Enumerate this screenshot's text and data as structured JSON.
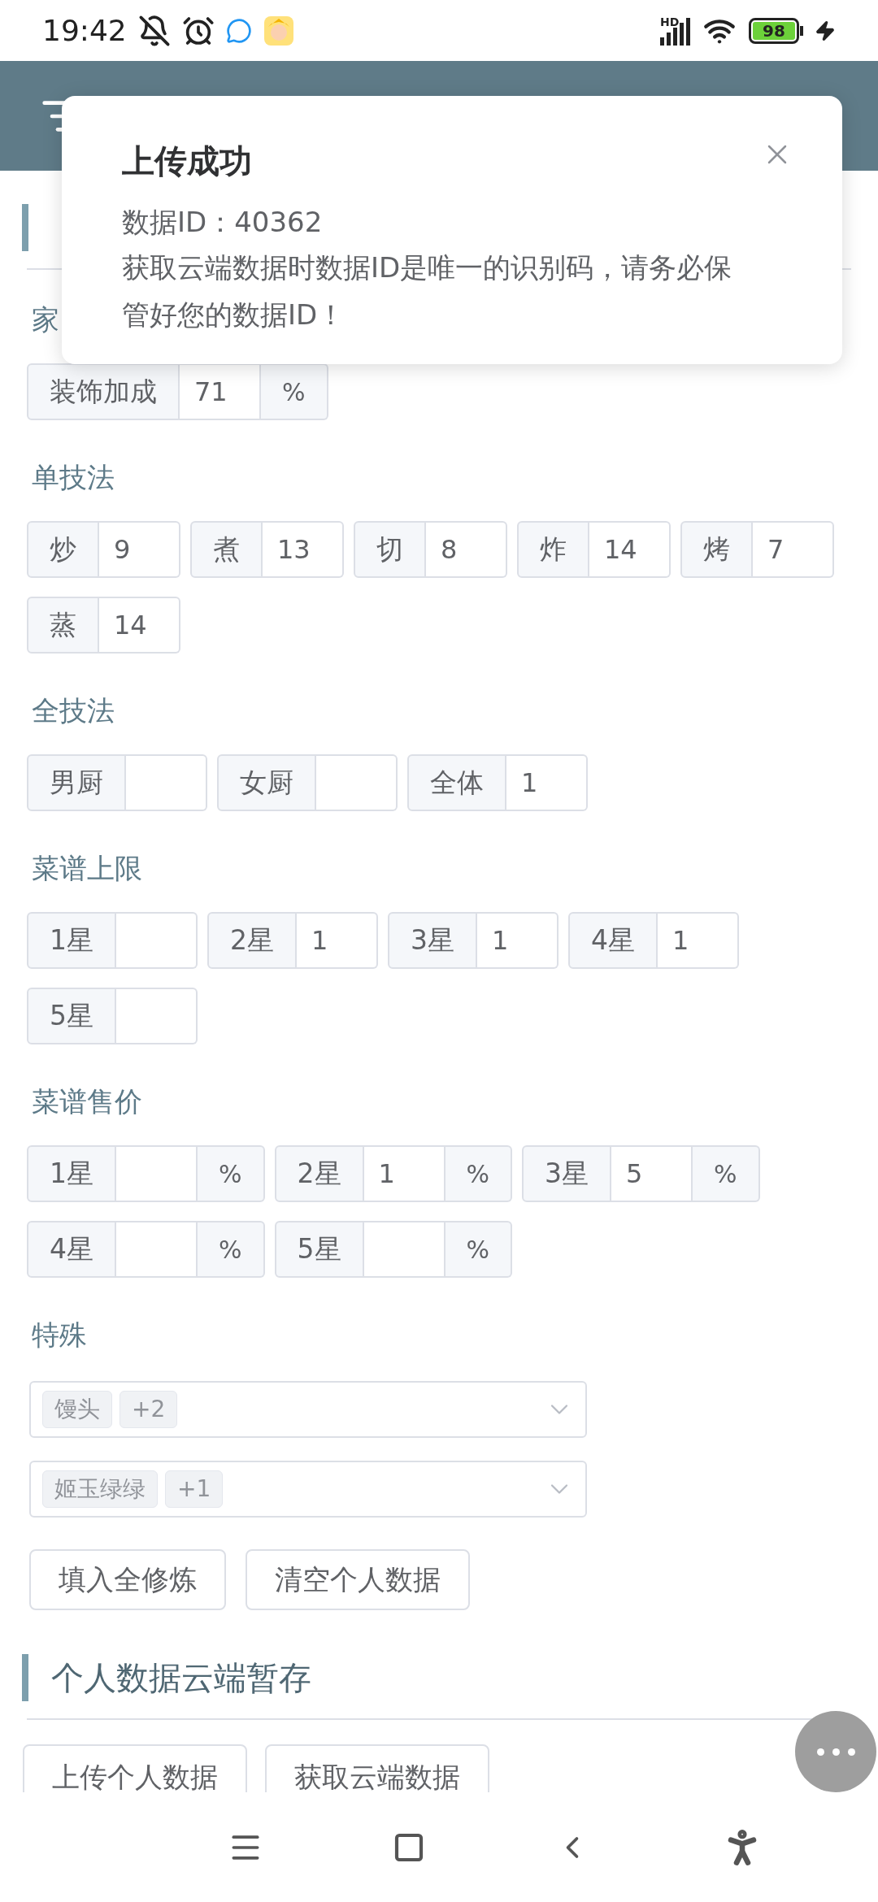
{
  "status_bar": {
    "time": "19:42",
    "network": "HD",
    "battery": "98"
  },
  "toast": {
    "title": "上传成功",
    "id_line": "数据ID：40362",
    "message": "获取云端数据时数据ID是唯一的识别码，请务必保管好您的数据ID！"
  },
  "personal": {
    "groups": [
      {
        "label": "家",
        "fields": [
          {
            "addon": "装饰加成",
            "value": "71",
            "suffix": "%"
          }
        ]
      },
      {
        "label": "单技法",
        "fields": [
          {
            "addon": "炒",
            "value": "9"
          },
          {
            "addon": "煮",
            "value": "13"
          },
          {
            "addon": "切",
            "value": "8"
          },
          {
            "addon": "炸",
            "value": "14"
          },
          {
            "addon": "烤",
            "value": "7"
          },
          {
            "addon": "蒸",
            "value": "14"
          }
        ]
      },
      {
        "label": "全技法",
        "fields": [
          {
            "addon": "男厨"
          },
          {
            "addon": "女厨"
          },
          {
            "addon": "全体",
            "value": "1"
          }
        ]
      },
      {
        "label": "菜谱上限",
        "fields": [
          {
            "addon": "1星"
          },
          {
            "addon": "2星",
            "value": "1"
          },
          {
            "addon": "3星",
            "value": "1"
          },
          {
            "addon": "4星",
            "value": "1"
          },
          {
            "addon": "5星"
          }
        ]
      },
      {
        "label": "菜谱售价",
        "fields": [
          {
            "addon": "1星",
            "suffix": "%"
          },
          {
            "addon": "2星",
            "value": "1",
            "suffix": "%"
          },
          {
            "addon": "3星",
            "value": "5",
            "suffix": "%"
          },
          {
            "addon": "4星",
            "suffix": "%"
          },
          {
            "addon": "5星",
            "suffix": "%"
          }
        ]
      }
    ],
    "special_label": "特殊",
    "specials": [
      {
        "tags": [
          "馒头",
          "+2"
        ]
      },
      {
        "tags": [
          "姬玉绿绿",
          "+1"
        ]
      }
    ],
    "buttons": [
      "填入全修炼",
      "清空个人数据"
    ]
  },
  "cloud": {
    "title": "个人数据云端暂存",
    "buttons": [
      "上传个人数据",
      "获取云端数据"
    ]
  }
}
